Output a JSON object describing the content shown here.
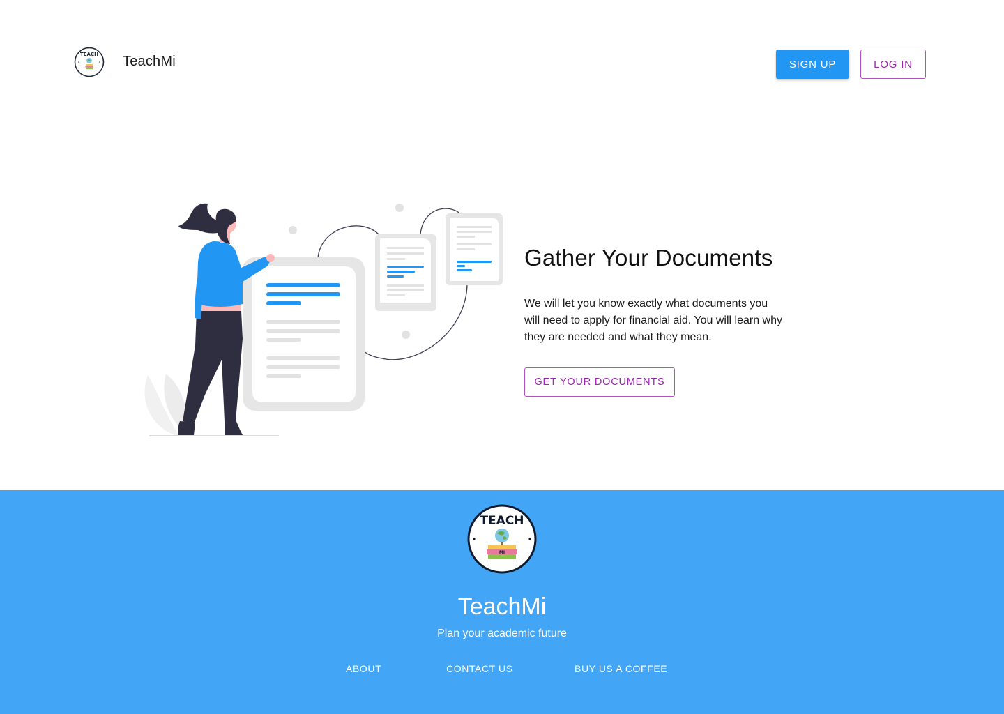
{
  "header": {
    "brand": "TeachMi",
    "logo_icon": "teachmi-globe-logo",
    "signup_label": "SIGN UP",
    "login_label": "LOG IN"
  },
  "hero": {
    "title": "Gather Your Documents",
    "text": "We will let you know exactly what documents you will need to apply for financial aid. You will learn why they are needed and what they mean.",
    "cta_label": "GET YOUR DOCUMENTS",
    "illustration_icon": "woman-with-documents-illustration"
  },
  "footer": {
    "logo_text_top": "TEACH",
    "logo_text_bottom": "MI",
    "brand": "TeachMi",
    "tagline": "Plan your academic future",
    "links": [
      "ABOUT",
      "CONTACT US",
      "BUY US A COFFEE"
    ]
  },
  "colors": {
    "primary": "#2196f3",
    "accent": "#9c27b0",
    "footer_bg": "#42a5f5"
  }
}
